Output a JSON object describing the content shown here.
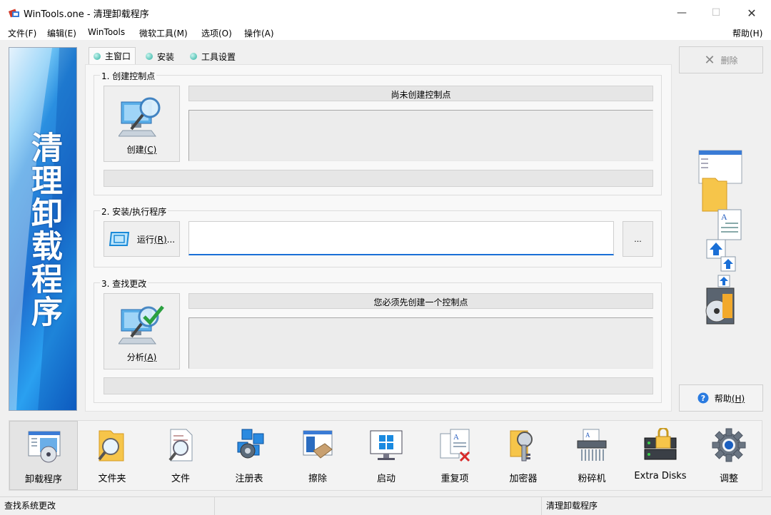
{
  "window": {
    "title": "WinTools.one - 清理卸载程序",
    "minimize_glyph": "—",
    "maximize_glyph": "☐",
    "close_glyph": "✕"
  },
  "menu": [
    "文件(F)",
    "编辑(E)",
    "WinTools",
    "微软工具(M)",
    "选项(O)",
    "操作(A)"
  ],
  "menu_help": "帮助(H)",
  "banner": {
    "text": "清理卸载程序"
  },
  "tabs": [
    {
      "label": "主窗口"
    },
    {
      "label": "安装"
    },
    {
      "label": "工具设置"
    }
  ],
  "section1": {
    "title": "1. 创建控制点",
    "button_label": "创建",
    "button_key": "(C)",
    "status_text": "尚未创建控制点"
  },
  "section2": {
    "title": "2. 安装/执行程序",
    "run_label": "运行",
    "run_key": "(R)",
    "run_suffix": "...",
    "browse_label": "...",
    "path_value": ""
  },
  "section3": {
    "title": "3. 查找更改",
    "button_label": "分析",
    "button_key": "(A)",
    "status_text": "您必须先创建一个控制点"
  },
  "right": {
    "delete_label": "删除",
    "help_label": "帮助",
    "help_key": "(H)"
  },
  "toolbar": [
    {
      "label": "卸载程序",
      "icon": "uninstall-icon"
    },
    {
      "label": "文件夹",
      "icon": "folder-search-icon"
    },
    {
      "label": "文件",
      "icon": "file-search-icon"
    },
    {
      "label": "注册表",
      "icon": "registry-icon"
    },
    {
      "label": "擦除",
      "icon": "eraser-icon"
    },
    {
      "label": "启动",
      "icon": "startup-icon"
    },
    {
      "label": "重复项",
      "icon": "duplicate-icon"
    },
    {
      "label": "加密器",
      "icon": "encrypt-icon"
    },
    {
      "label": "粉碎机",
      "icon": "shredder-icon"
    },
    {
      "label": "Extra Disks",
      "icon": "extra-disks-icon"
    },
    {
      "label": "调整",
      "icon": "gear-icon"
    }
  ],
  "status": {
    "left": "查找系统更改",
    "right": "清理卸载程序"
  },
  "colors": {
    "banner_blue": "#1e6fd0",
    "accent_blue": "#1a6fd6",
    "help_icon": "#2a7be0"
  }
}
